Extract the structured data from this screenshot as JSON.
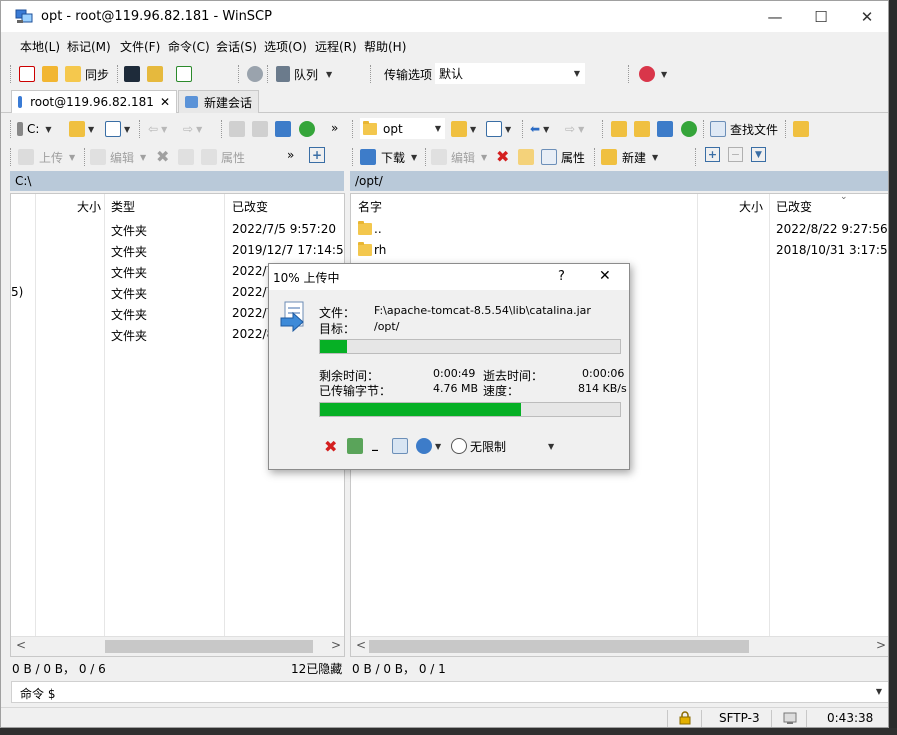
{
  "window": {
    "title": "opt - root@119.96.82.181 - WinSCP",
    "minimize": "—",
    "maximize": "☐",
    "close": "✕"
  },
  "menu": [
    "本地(L)",
    "标记(M)",
    "文件(F)",
    "命令(C)",
    "会话(S)",
    "选项(O)",
    "远程(R)",
    "帮助(H)"
  ],
  "toolbar1": {
    "sync_label": "同步",
    "queue_label": "队列",
    "transfer_options_label": "传输选项",
    "transfer_preset": "默认"
  },
  "tabs": {
    "active": "root@119.96.82.181",
    "active_close": "✕",
    "new_session": "新建会话"
  },
  "local": {
    "drive": "C:",
    "upload_label": "上传",
    "edit_label": "编辑",
    "properties_label": "属性",
    "more": "»",
    "plus": "+",
    "path": "C:\\",
    "columns": {
      "size": "大小",
      "type": "类型",
      "changed": "已改变"
    },
    "rows": [
      {
        "name": "",
        "type": "文件夹",
        "changed": "2022/7/5  9:57:20"
      },
      {
        "name": "",
        "type": "文件夹",
        "changed": "2019/12/7  17:14:52"
      },
      {
        "name": "",
        "type": "文件夹",
        "changed": "2022/7"
      },
      {
        "name": "5)",
        "type": "文件夹",
        "changed": "2022/7"
      },
      {
        "name": "",
        "type": "文件夹",
        "changed": "2022/7"
      },
      {
        "name": "",
        "type": "文件夹",
        "changed": "2022/8"
      }
    ],
    "status": "0 B / 0 B， 0 / 6",
    "hidden": "12已隐藏"
  },
  "remote": {
    "folder": "opt",
    "download_label": "下载",
    "edit_label": "编辑",
    "properties_label": "属性",
    "new_label": "新建",
    "find_label": "查找文件",
    "path": "/opt/",
    "columns": {
      "name": "名字",
      "size": "大小",
      "changed": "已改变"
    },
    "rows": [
      {
        "name": "..",
        "changed": "2022/8/22 9:27:56"
      },
      {
        "name": "rh",
        "changed": "2018/10/31 3:17:56"
      }
    ],
    "status": "0 B / 0 B， 0 / 1"
  },
  "command": {
    "label": "命令 $",
    "value": ""
  },
  "statusbar": {
    "protocol": "SFTP-3",
    "time": "0:43:38"
  },
  "dialog": {
    "title": "10% 上传中",
    "help": "?",
    "close": "✕",
    "file_label": "文件：",
    "file_value": "F:\\apache-tomcat-8.5.54\\lib\\catalina.jar",
    "target_label": "目标：",
    "target_value": "/opt/",
    "file_progress": 0.09,
    "remaining_label": "剩余时间：",
    "remaining_value": "0:00:49",
    "elapsed_label": "逝去时间：",
    "elapsed_value": "0:00:06",
    "transferred_label": "已传输字节：",
    "transferred_value": "4.76 MB",
    "speed_label": "速度：",
    "speed_value": "814 KB/s",
    "total_progress": 0.67,
    "speed_limit_label": "无限制",
    "minimize_glyph": "_"
  },
  "colors": {
    "progress": "#06b025",
    "path_bar": "#b9c9d9",
    "window_bg": "#f0f0f0"
  }
}
